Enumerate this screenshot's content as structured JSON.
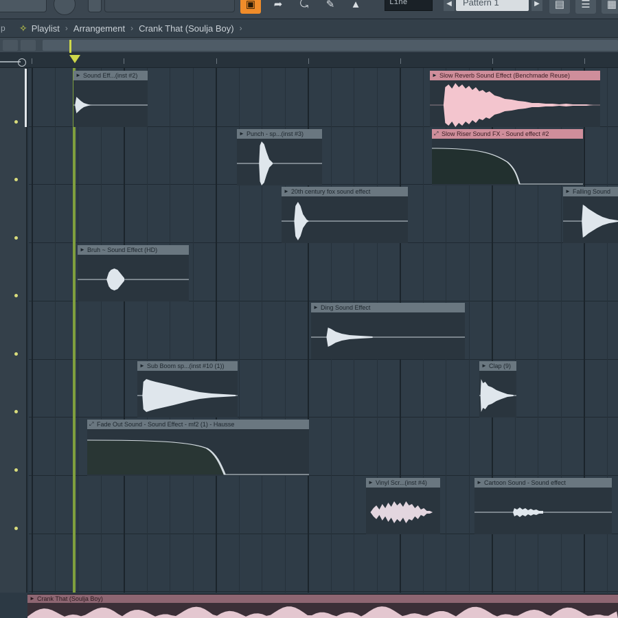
{
  "toolbar": {
    "pattern_display": "Pattern 1",
    "tempo_display": "Line",
    "icons": [
      "record-icon",
      "undo-icon",
      "metronome-icon",
      "pattern-arrow-icon",
      "plugin-icon",
      "piano-roll-icon",
      "mixer-icon"
    ]
  },
  "titlebar": {
    "left_fragment": "p",
    "playlist": "Playlist",
    "arrangement": "Arrangement",
    "song": "Crank That (Soulja Boy)"
  },
  "colors": {
    "accent_orange": "#f08c2a",
    "playhead": "#cfd84a",
    "clip_header": "#6a7780",
    "clip_header_selected": "#cf8e9b",
    "wave_light": "#dfe6ec",
    "wave_pink": "#f3c5ce"
  },
  "clips": [
    {
      "id": "c1",
      "name": "Sound Eff...(inst #2)",
      "style": "normal",
      "wave": "spike"
    },
    {
      "id": "c2",
      "name": "Slow Reverb Sound Effect (Benchmade Reuse)",
      "style": "pink",
      "wave": "dense"
    },
    {
      "id": "c3",
      "name": "Punch - sp...(inst #3)",
      "style": "normal",
      "wave": "blob"
    },
    {
      "id": "c4",
      "name": "Slow Riser Sound FX - Sound effect #2",
      "style": "pink",
      "wave": "automation"
    },
    {
      "id": "c5",
      "name": "20th century fox sound effect",
      "style": "normal",
      "wave": "blob"
    },
    {
      "id": "c6",
      "name": "Falling Sound",
      "style": "normal",
      "wave": "decay"
    },
    {
      "id": "c7",
      "name": "Bruh ~ Sound Effect (HD)",
      "style": "normal",
      "wave": "burst"
    },
    {
      "id": "c8",
      "name": "Ding Sound Effect",
      "style": "normal",
      "wave": "decay"
    },
    {
      "id": "c9",
      "name": "Sub Boom sp...(inst #10 (1))",
      "style": "normal",
      "wave": "big"
    },
    {
      "id": "c10",
      "name": "Clap (9)",
      "style": "normal",
      "wave": "small"
    },
    {
      "id": "c11",
      "name": "Fade Out Sound - Sound Effect - mf2 (1) - Hausse",
      "style": "normal",
      "wave": "automation"
    },
    {
      "id": "c12",
      "name": "Vinyl Scr...(inst #4)",
      "style": "normal",
      "wave": "noise"
    },
    {
      "id": "c13",
      "name": "Cartoon Sound - Sound effect",
      "style": "normal",
      "wave": "noise-small"
    }
  ],
  "bottom_track": {
    "name": "Crank That (Soulja Boy)"
  }
}
